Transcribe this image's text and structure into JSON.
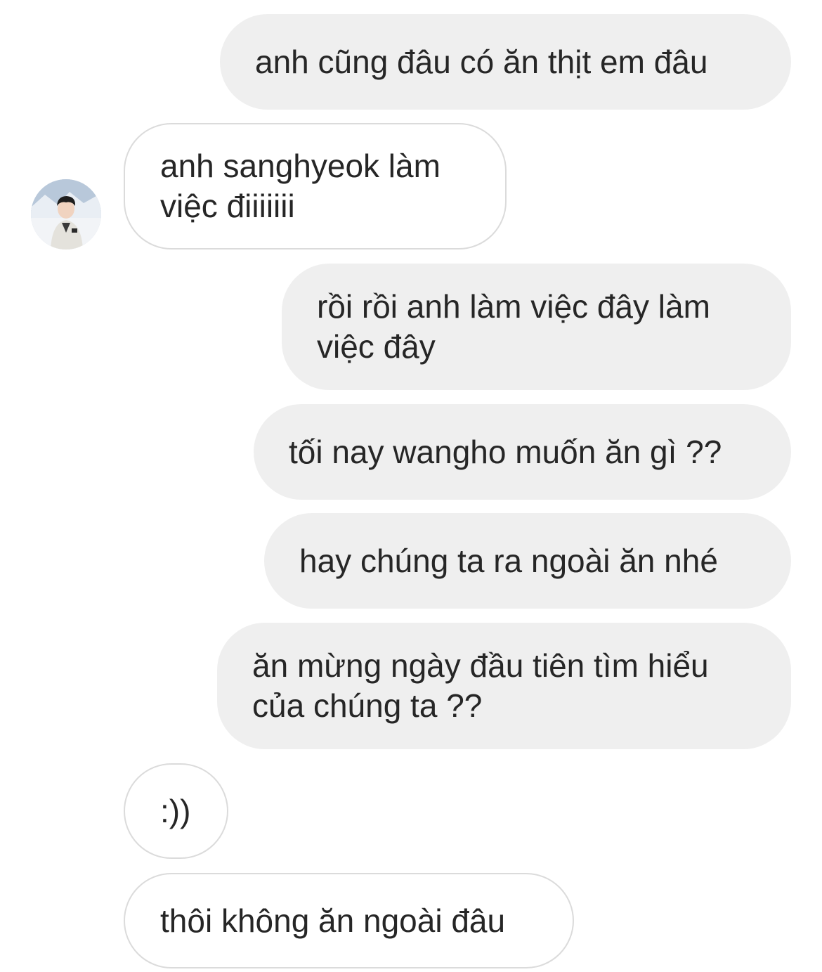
{
  "conversation": {
    "messages": [
      {
        "from": "me",
        "text": "anh cũng đâu có ăn thịt em đâu"
      },
      {
        "from": "them",
        "text": "anh sanghyeok làm\nviệc điiiiiii"
      },
      {
        "from": "me",
        "text": "rồi rồi anh làm việc đây làm\nviệc đây"
      },
      {
        "from": "me",
        "text": "tối nay wangho muốn ăn gì ??"
      },
      {
        "from": "me",
        "text": "hay chúng ta ra ngoài ăn nhé"
      },
      {
        "from": "me",
        "text": "ăn mừng ngày đầu tiên tìm hiểu\ncủa chúng ta ??"
      },
      {
        "from": "them",
        "text": ":))"
      },
      {
        "from": "them",
        "text": "thôi không ăn ngoài đâu"
      }
    ]
  },
  "colors": {
    "sent_bubble": "#efefef",
    "received_bubble": "#ffffff",
    "received_border": "#dbdbdb",
    "text": "#262626"
  },
  "icons": {
    "avatar": "contact-avatar-photo"
  }
}
